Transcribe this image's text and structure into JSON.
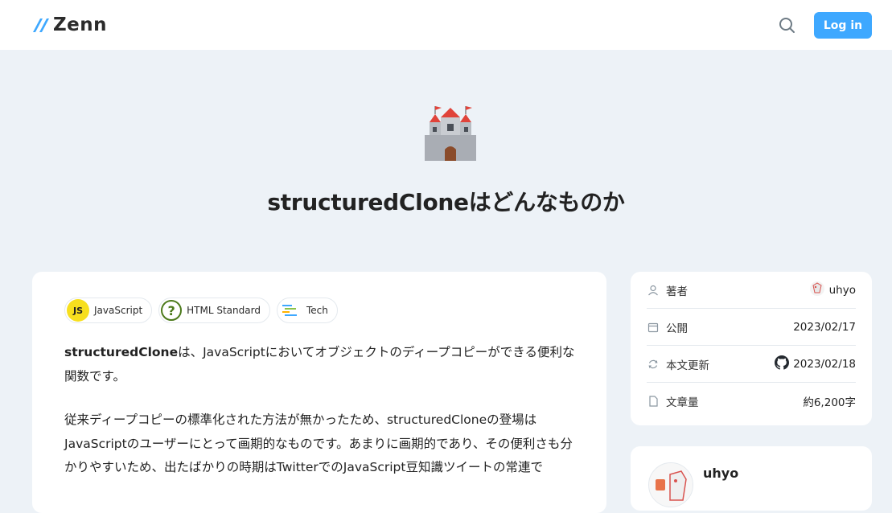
{
  "header": {
    "logo_text": "Zenn",
    "login_label": "Log in"
  },
  "article": {
    "emoji_icon": "castle-emoji",
    "title": "structuredCloneはどんなものか",
    "topics": [
      {
        "label": "JavaScript",
        "icon": "javascript-icon",
        "icon_text": "JS"
      },
      {
        "label": "HTML Standard",
        "icon": "question-icon",
        "icon_text": "?"
      },
      {
        "label": "Tech",
        "icon": "tech-icon"
      }
    ],
    "paragraphs": [
      {
        "bold": "structuredClone",
        "text": "は、JavaScriptにおいてオブジェクトのディープコピーができる便利な関数です。"
      },
      {
        "bold": "",
        "text": "従来ディープコピーの標準化された方法が無かったため、structuredCloneの登場はJavaScriptのユーザーにとって画期的なものです。あまりに画期的であり、その便利さも分かりやすいため、出たばかりの時期はTwitterでのJavaScript豆知識ツイートの常連で"
      }
    ]
  },
  "info": {
    "rows": [
      {
        "label": "著者",
        "value": "uhyo",
        "icon": "person-icon"
      },
      {
        "label": "公開",
        "value": "2023/02/17",
        "icon": "calendar-icon"
      },
      {
        "label": "本文更新",
        "value": "2023/02/18",
        "icon": "refresh-icon",
        "value_icon": "github-icon"
      },
      {
        "label": "文章量",
        "value": "約6,200字",
        "icon": "file-icon"
      }
    ]
  },
  "author": {
    "name": "uhyo"
  },
  "colors": {
    "accent": "#3ea8ff",
    "background": "#edf2f7"
  }
}
